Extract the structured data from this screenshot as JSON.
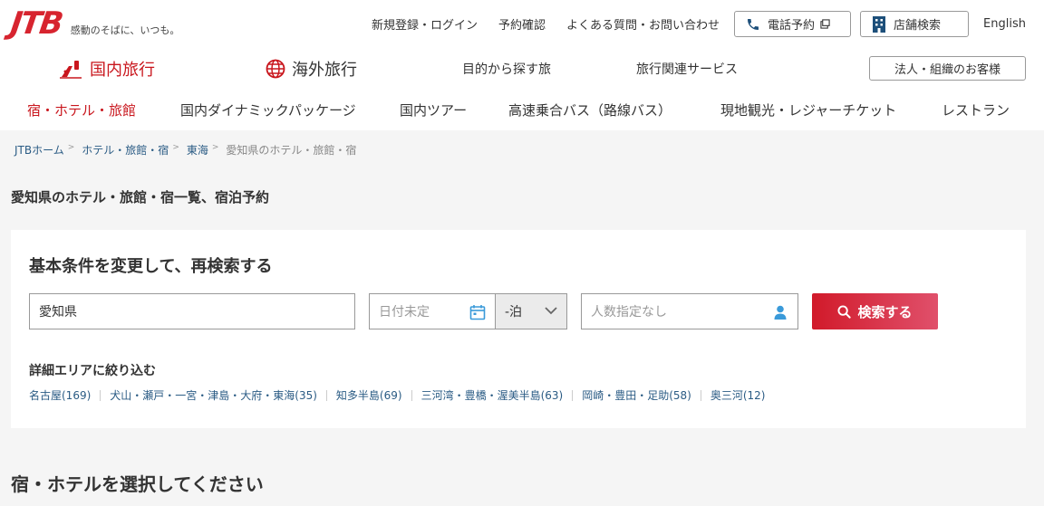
{
  "brand": {
    "logo": "JTB",
    "tagline": "感動のそばに、いつも。",
    "accent": "#d7242f"
  },
  "utility": {
    "register_login": "新規登録・ログイン",
    "reservation_check": "予約確認",
    "faq_contact": "よくある質問・お問い合わせ",
    "phone_booking": "電話予約",
    "store_search": "店舗検索",
    "language": "English"
  },
  "main_nav": {
    "domestic": "国内旅行",
    "overseas": "海外旅行",
    "purpose": "目的から探す旅",
    "services": "旅行関連サービス",
    "corporate": "法人・組織のお客様"
  },
  "sub_nav": [
    "宿・ホテル・旅館",
    "国内ダイナミックパッケージ",
    "国内ツアー",
    "高速乗合バス（路線バス）",
    "現地観光・レジャーチケット",
    "レストラン"
  ],
  "breadcrumb": [
    "JTBホーム",
    "ホテル・旅館・宿",
    "東海",
    "愛知県のホテル・旅館・宿"
  ],
  "page_title": "愛知県のホテル・旅館・宿一覧、宿泊予約",
  "search": {
    "title": "基本条件を変更して、再検索する",
    "prefecture_value": "愛知県",
    "date_placeholder": "日付未定",
    "nights_value": "-泊",
    "people_placeholder": "人数指定なし",
    "button_label": "検索する"
  },
  "area": {
    "title": "詳細エリアに絞り込む",
    "items": [
      "名古屋(169)",
      "犬山・瀬戸・一宮・津島・大府・東海(35)",
      "知多半島(69)",
      "三河湾・豊橋・渥美半島(63)",
      "岡崎・豊田・足助(58)",
      "奥三河(12)"
    ]
  },
  "select_title": "宿・ホテルを選択してください"
}
